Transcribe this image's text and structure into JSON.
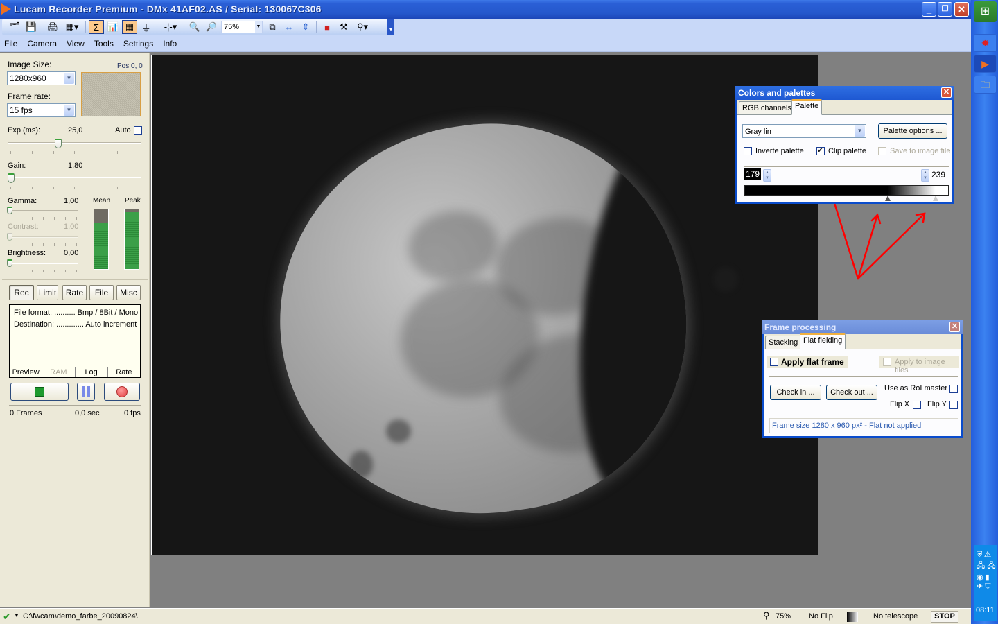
{
  "window": {
    "title": "Lucam Recorder Premium - DMx 41AF02.AS / Serial: 130067C306",
    "controls": {
      "minimize": "_",
      "restore": "❐",
      "close": "✕"
    }
  },
  "toolbar": {
    "zoom_value": "75%",
    "icons": [
      "open-icon",
      "save-icon",
      "print-icon",
      "grid-icon",
      "sum-icon",
      "histogram-icon",
      "overlay-icon",
      "filter-icon",
      "crosshair-icon",
      "zoom-in-icon",
      "zoom-out-icon",
      "fit-window-icon",
      "fit-width-icon",
      "fit-height-icon",
      "monitor-icon",
      "tools-icon",
      "telescope-icon"
    ]
  },
  "menu": [
    "File",
    "Camera",
    "View",
    "Tools",
    "Settings",
    "Info"
  ],
  "left_panel": {
    "image_size_label": "Image Size:",
    "image_size_value": "1280x960",
    "pos_label": "Pos 0, 0",
    "frame_rate_label": "Frame rate:",
    "frame_rate_value": "15 fps",
    "exposure": {
      "label": "Exp (ms):",
      "value": "25,0",
      "auto_label": "Auto",
      "auto_checked": false,
      "slider_fraction": 0.4
    },
    "gain": {
      "label": "Gain:",
      "value": "1,80",
      "slider_fraction": 0.0
    },
    "gamma": {
      "label": "Gamma:",
      "value": "1,00",
      "slider_fraction": 0.0
    },
    "contrast": {
      "label": "Contrast:",
      "value": "1,00",
      "disabled": true,
      "slider_fraction": 0.0
    },
    "brightness": {
      "label": "Brightness:",
      "value": "0,00",
      "slider_fraction": 0.0
    },
    "meters": {
      "mean_label": "Mean",
      "mean_fraction": 0.77,
      "peak_label": "Peak",
      "peak_fraction": 0.95
    },
    "rec_tabs": [
      "Rec",
      "Limit",
      "Rate",
      "File",
      "Misc"
    ],
    "info": {
      "file_format": "File format: .......... Bmp / 8Bit / Mono",
      "destination": "Destination: ............. Auto increment",
      "footer": [
        "Preview",
        "RAM",
        "Log",
        "Rate"
      ]
    },
    "stats": {
      "frames": "0 Frames",
      "seconds": "0,0 sec",
      "fps": "0 fps"
    }
  },
  "colors_palettes": {
    "title": "Colors and palettes",
    "tabs": [
      "RGB channels",
      "Palette"
    ],
    "active_tab": "Palette",
    "palette_value": "Gray lin",
    "palette_options_label": "Palette options ...",
    "invert_label": "Inverte palette",
    "invert_checked": false,
    "clip_label": "Clip palette",
    "clip_checked": true,
    "save_label": "Save to image file",
    "save_checked": false,
    "low_value": "179",
    "high_value": "239"
  },
  "frame_processing": {
    "title": "Frame processing",
    "tabs": [
      "Stacking",
      "Flat fielding"
    ],
    "active_tab": "Flat fielding",
    "apply_flat_label": "Apply flat frame",
    "apply_image_files_label": "Apply to image files",
    "check_in_label": "Check in ...",
    "check_out_label": "Check out ...",
    "roi_master_label": "Use as RoI master",
    "flip_x_label": "Flip X",
    "flip_y_label": "Flip Y",
    "status": "Frame size 1280 x 960 px² - Flat not applied"
  },
  "statusbar": {
    "path": "C:\\fwcam\\demo_farbe_20090824\\",
    "zoom": "75%",
    "flip": "No Flip",
    "telescope": "No telescope",
    "stop_label": "STOP"
  },
  "taskbar": {
    "clock": "08:11"
  },
  "colors": {
    "accent": "#0a4ccc",
    "annotation_arrow": "#ff0000"
  }
}
